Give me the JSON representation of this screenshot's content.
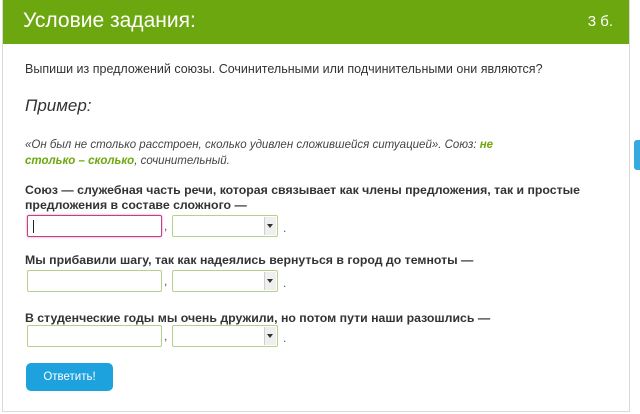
{
  "header": {
    "title": "Условие задания:",
    "points": "3 б."
  },
  "question": "Выпиши из предложений союзы. Сочинительными или подчинительными они являются?",
  "example": {
    "heading": "Пример:",
    "text": "«Он был не столько расстроен, сколько удивлен сложившейся ситуацией». Союз: ",
    "highlight": "не столько – сколько",
    "tail": ", сочинительный."
  },
  "tasks": [
    {
      "sentence": "Союз — служебная часть речи, которая связывает как члены предложения, так и простые предложения в составе сложного —",
      "answer": "",
      "type_selected": ""
    },
    {
      "sentence": "Мы прибавили шагу, так как надеялись вернуться в город до темноты —",
      "answer": "",
      "type_selected": ""
    },
    {
      "sentence": "В студенческие годы мы очень дружили, но потом пути наши разошлись —",
      "answer": "",
      "type_selected": ""
    }
  ],
  "separator": ",",
  "end_mark": ".",
  "submit_label": "Ответить!",
  "colors": {
    "header": "#6da70f",
    "button": "#1ea2dd",
    "highlight": "#6da70f",
    "active_border": "#c13f8b"
  },
  "icons": {
    "dropdown": "chevron-down-icon"
  }
}
